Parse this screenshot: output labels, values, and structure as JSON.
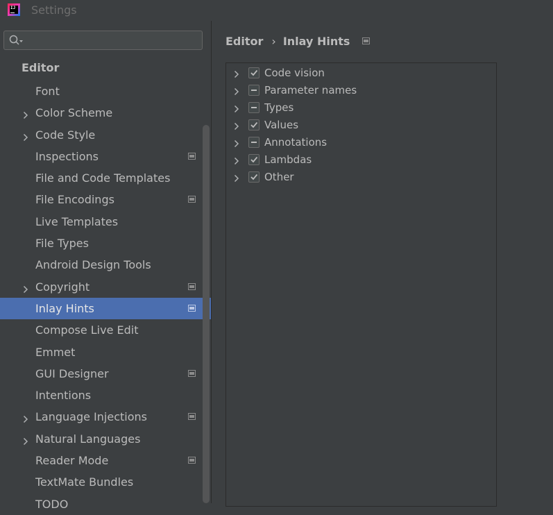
{
  "window": {
    "title": "Settings",
    "logo_text": "IJ"
  },
  "search": {
    "placeholder": "",
    "value": ""
  },
  "sidebar": {
    "section_title": "Editor",
    "items": [
      {
        "label": "Font",
        "expandable": false,
        "project_icon": false,
        "selected": false
      },
      {
        "label": "Color Scheme",
        "expandable": true,
        "project_icon": false,
        "selected": false
      },
      {
        "label": "Code Style",
        "expandable": true,
        "project_icon": false,
        "selected": false
      },
      {
        "label": "Inspections",
        "expandable": false,
        "project_icon": true,
        "selected": false
      },
      {
        "label": "File and Code Templates",
        "expandable": false,
        "project_icon": false,
        "selected": false
      },
      {
        "label": "File Encodings",
        "expandable": false,
        "project_icon": true,
        "selected": false
      },
      {
        "label": "Live Templates",
        "expandable": false,
        "project_icon": false,
        "selected": false
      },
      {
        "label": "File Types",
        "expandable": false,
        "project_icon": false,
        "selected": false
      },
      {
        "label": "Android Design Tools",
        "expandable": false,
        "project_icon": false,
        "selected": false
      },
      {
        "label": "Copyright",
        "expandable": true,
        "project_icon": true,
        "selected": false
      },
      {
        "label": "Inlay Hints",
        "expandable": false,
        "project_icon": true,
        "selected": true
      },
      {
        "label": "Compose Live Edit",
        "expandable": false,
        "project_icon": false,
        "selected": false
      },
      {
        "label": "Emmet",
        "expandable": false,
        "project_icon": false,
        "selected": false
      },
      {
        "label": "GUI Designer",
        "expandable": false,
        "project_icon": true,
        "selected": false
      },
      {
        "label": "Intentions",
        "expandable": false,
        "project_icon": false,
        "selected": false
      },
      {
        "label": "Language Injections",
        "expandable": true,
        "project_icon": true,
        "selected": false
      },
      {
        "label": "Natural Languages",
        "expandable": true,
        "project_icon": false,
        "selected": false
      },
      {
        "label": "Reader Mode",
        "expandable": false,
        "project_icon": true,
        "selected": false
      },
      {
        "label": "TextMate Bundles",
        "expandable": false,
        "project_icon": false,
        "selected": false
      },
      {
        "label": "TODO",
        "expandable": false,
        "project_icon": false,
        "selected": false
      }
    ]
  },
  "breadcrumb": {
    "parent": "Editor",
    "separator": "›",
    "current": "Inlay Hints"
  },
  "hints_tree": {
    "items": [
      {
        "label": "Code vision",
        "state": "checked"
      },
      {
        "label": "Parameter names",
        "state": "partial"
      },
      {
        "label": "Types",
        "state": "partial"
      },
      {
        "label": "Values",
        "state": "checked"
      },
      {
        "label": "Annotations",
        "state": "partial"
      },
      {
        "label": "Lambdas",
        "state": "checked"
      },
      {
        "label": "Other",
        "state": "checked"
      }
    ]
  },
  "colors": {
    "background": "#3c3f41",
    "selection": "#4b6eaf",
    "text": "#bbbbbb",
    "border": "#2b2b2b"
  }
}
